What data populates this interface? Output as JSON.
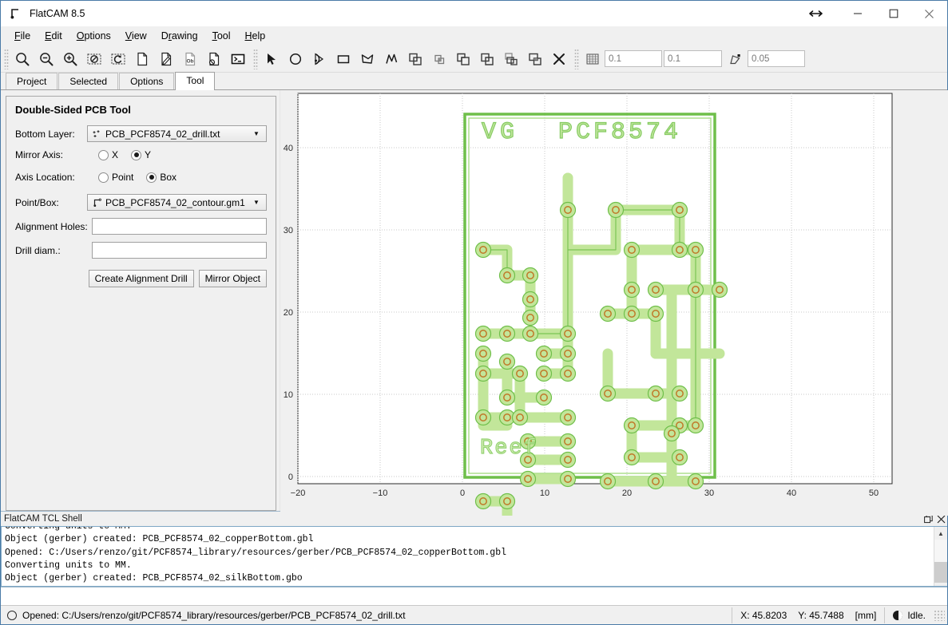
{
  "window": {
    "title": "FlatCAM 8.5",
    "app_icon": "flatcam-logo-icon",
    "controls": {
      "restore_arrows": "↔",
      "minimize": "─",
      "maximize": "□",
      "close": "✕"
    }
  },
  "menubar": {
    "items": [
      {
        "label": "File",
        "mnemonic": "F"
      },
      {
        "label": "Edit",
        "mnemonic": "E"
      },
      {
        "label": "Options",
        "mnemonic": "O"
      },
      {
        "label": "View",
        "mnemonic": "V"
      },
      {
        "label": "Drawing",
        "mnemonic": "D"
      },
      {
        "label": "Tool",
        "mnemonic": "T"
      },
      {
        "label": "Help",
        "mnemonic": "H"
      }
    ]
  },
  "toolbar": {
    "file_group": [
      {
        "name": "zoom-fit-icon",
        "title": "Zoom Fit"
      },
      {
        "name": "zoom-out-icon",
        "title": "Zoom Out"
      },
      {
        "name": "zoom-in-icon",
        "title": "Zoom In"
      },
      {
        "name": "clear-plot-icon",
        "title": "Clear Plot"
      },
      {
        "name": "replot-icon",
        "title": "Replot"
      },
      {
        "name": "new-project-icon",
        "title": "New Project"
      },
      {
        "name": "open-project-icon",
        "title": "Open Project"
      },
      {
        "name": "open-gerber-icon",
        "title": "Open Gerber"
      },
      {
        "name": "open-excellon-icon",
        "title": "Open Excellon"
      },
      {
        "name": "shell-icon",
        "title": "Command Line"
      }
    ],
    "draw_group": [
      {
        "name": "select-arrow-icon",
        "title": "Select"
      },
      {
        "name": "circle-icon",
        "title": "Add Circle"
      },
      {
        "name": "arc-icon",
        "title": "Add Arc"
      },
      {
        "name": "rectangle-icon",
        "title": "Add Rectangle"
      },
      {
        "name": "polygon-icon",
        "title": "Add Polygon"
      },
      {
        "name": "path-icon",
        "title": "Add Path"
      },
      {
        "name": "union-icon",
        "title": "Polygon Union"
      },
      {
        "name": "intersection-icon",
        "title": "Polygon Intersection"
      },
      {
        "name": "subtract-icon",
        "title": "Polygon Subtraction"
      },
      {
        "name": "cut-path-icon",
        "title": "Cut Path"
      },
      {
        "name": "copy-shape-icon",
        "title": "Copy Shape"
      },
      {
        "name": "move-shape-icon",
        "title": "Move Shape"
      },
      {
        "name": "delete-shape-icon",
        "title": "Delete Shape"
      }
    ],
    "snap": {
      "grid_icon": "snap-grid-icon",
      "grid_x": "0.1",
      "grid_y": "0.1",
      "corner_icon": "snap-corner-icon",
      "max_distance": "0.05"
    }
  },
  "tabs": {
    "items": [
      "Project",
      "Selected",
      "Options",
      "Tool"
    ],
    "active": "Tool"
  },
  "tool_panel": {
    "title": "Double-Sided PCB Tool",
    "bottom_layer": {
      "label": "Bottom Layer:",
      "icon": "excellon-drill-icon",
      "value": "PCB_PCF8574_02_drill.txt"
    },
    "mirror_axis": {
      "label": "Mirror Axis:",
      "options": [
        "X",
        "Y"
      ],
      "selected": "Y"
    },
    "axis_location": {
      "label": "Axis Location:",
      "options": [
        "Point",
        "Box"
      ],
      "selected": "Box"
    },
    "point_box": {
      "label": "Point/Box:",
      "icon": "gerber-object-icon",
      "value": "PCB_PCF8574_02_contour.gm1"
    },
    "alignment_holes": {
      "label": "Alignment Holes:",
      "value": "",
      "placeholder": ""
    },
    "drill_diam": {
      "label": "Drill diam.:",
      "value": "",
      "placeholder": ""
    },
    "buttons": {
      "create_alignment_drill": "Create Alignment Drill",
      "mirror_object": "Mirror Object"
    }
  },
  "shell": {
    "title": "FlatCAM TCL Shell",
    "float_icon": "float-panel-icon",
    "close_icon": "close-panel-icon",
    "lines": [
      "Converting units to MM.",
      "Object (gerber) created: PCB_PCF8574_02_copperBottom.gbl",
      "Opened: C:/Users/renzo/git/PCF8574_library/resources/gerber/PCB_PCF8574_02_copperBottom.gbl",
      "Converting units to MM.",
      "Object (gerber) created: PCB_PCF8574_02_silkBottom.gbo"
    ]
  },
  "statusbar": {
    "message": "Opened: C:/Users/renzo/git/PCF8574_library/resources/gerber/PCB_PCF8574_02_drill.txt",
    "coord_x": "X: 45.8203",
    "coord_y": "Y: 45.7488",
    "units": "[mm]",
    "activity": "Idle."
  },
  "chart_data": {
    "type": "scatter",
    "title": "",
    "xlabel": "",
    "ylabel": "",
    "xlim": [
      -22.5,
      55
    ],
    "ylim": [
      -2.5,
      47
    ],
    "xticks": [
      -20,
      -10,
      0,
      10,
      20,
      30,
      40,
      50
    ],
    "yticks": [
      0,
      10,
      20,
      30,
      40
    ],
    "grid": true,
    "colors": {
      "trace_fill": "#c2e69a",
      "trace_stroke": "#6fbf4a",
      "pad_hole_stroke": "#c07828",
      "background": "#ffffff",
      "grid_line": "#d0d0d0"
    },
    "board_outline": {
      "x": 0,
      "y": 0,
      "width": 29.5,
      "height": 41.5
    },
    "silkscreen": [
      {
        "text": "VG",
        "x": 4.0,
        "y": 38.0
      },
      {
        "text": "PCF8574",
        "x": 12.5,
        "y": 38.0
      },
      {
        "text": "Reef",
        "x": 3.5,
        "y": 3.5
      }
    ]
  }
}
